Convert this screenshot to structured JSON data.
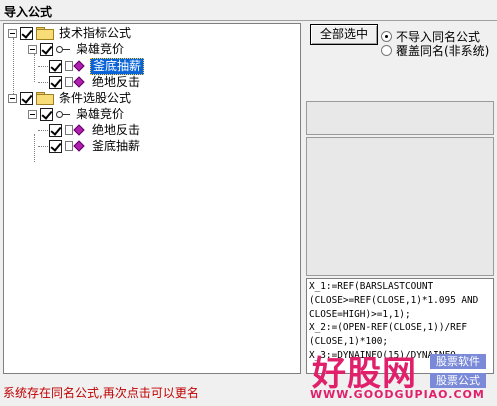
{
  "window": {
    "title": "导入公式"
  },
  "tree": {
    "nodes": [
      {
        "label": "技术指标公式",
        "type": "folder"
      },
      {
        "label": "枭雄竞价",
        "type": "key"
      },
      {
        "label": "釜底抽薪",
        "type": "formula",
        "selected": true
      },
      {
        "label": "绝地反击",
        "type": "formula"
      },
      {
        "label": "条件选股公式",
        "type": "folder"
      },
      {
        "label": "枭雄竞价",
        "type": "key"
      },
      {
        "label": "绝地反击",
        "type": "formula"
      },
      {
        "label": "釜底抽薪",
        "type": "formula"
      }
    ]
  },
  "controls": {
    "select_all": "全部选中",
    "radio_no_import": "不导入同名公式",
    "radio_overwrite": "覆盖同名(非系统)"
  },
  "code": {
    "lines": [
      "X_1:=REF(BARSLASTCOUNT",
      "(CLOSE>=REF(CLOSE,1)*1.095 AND",
      "CLOSE=HIGH)>=1,1);",
      "X_2:=(OPEN-REF(CLOSE,1))/REF",
      "(CLOSE,1)*100;",
      "X_3:=DYNAINFO(15)/DYNAINFO"
    ]
  },
  "status": {
    "message": "系统存在同名公式,再次点击可以更名"
  },
  "watermark": {
    "brand": "好股网",
    "tag1": "股票软件",
    "tag2": "股票公式",
    "url": "WWW.GOODGUPIAO.COM"
  },
  "colors": {
    "selection": "#0a64d8",
    "status_text": "#c00000",
    "watermark": "#e0206a"
  }
}
